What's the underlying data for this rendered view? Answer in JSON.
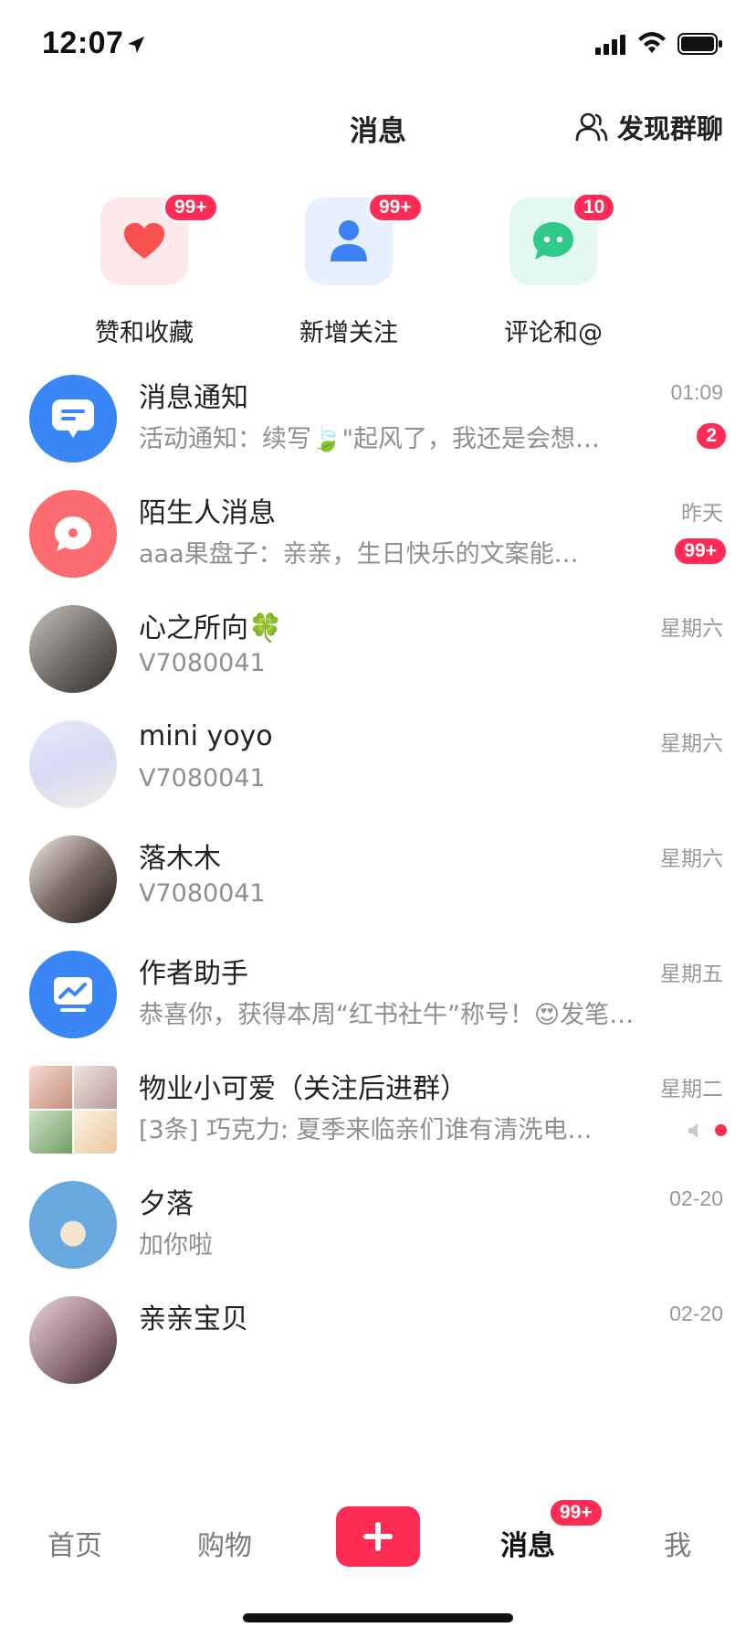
{
  "status_bar": {
    "time": "12:07"
  },
  "header": {
    "title": "消息",
    "discover_label": "发现群聊"
  },
  "shortcuts": [
    {
      "label": "赞和收藏",
      "badge": "99+",
      "icon": "heart-icon",
      "tile_color": "#fde9ea",
      "icon_color": "#f6504f"
    },
    {
      "label": "新增关注",
      "badge": "99+",
      "icon": "person-icon",
      "tile_color": "#e7f0fe",
      "icon_color": "#3b82f6"
    },
    {
      "label": "评论和@",
      "badge": "10",
      "icon": "chat-bubble-icon",
      "tile_color": "#e3f8ef",
      "icon_color": "#2fc98a"
    }
  ],
  "conversations": [
    {
      "title": "消息通知",
      "subtitle": "活动通知：续写🍃\"起风了，我还是会想…",
      "time": "01:09",
      "badge": "2"
    },
    {
      "title": "陌生人消息",
      "subtitle": "aaa果盘子：亲亲，生日快乐的文案能…",
      "time": "昨天",
      "badge": "99+"
    },
    {
      "title": "心之所向🍀",
      "subtitle": "V7080041",
      "time": "星期六"
    },
    {
      "title": "mini yoyo",
      "subtitle": "V7080041",
      "time": "星期六"
    },
    {
      "title": "落木木",
      "subtitle": "V7080041",
      "time": "星期六"
    },
    {
      "title": "作者助手",
      "subtitle": "恭喜你，获得本周“红书社牛”称号！😍发笔…",
      "time": "星期五"
    },
    {
      "title": "物业小可爱（关注后进群）",
      "subtitle": "[3条] 巧克力: 夏季来临亲们谁有清洗电…",
      "time": "星期二"
    },
    {
      "title": "夕落",
      "subtitle": "加你啦",
      "time": "02-20"
    },
    {
      "title": "亲亲宝贝",
      "subtitle": "",
      "time": "02-20"
    }
  ],
  "nav": {
    "items": [
      "首页",
      "购物",
      "消息",
      "我"
    ],
    "messages_badge": "99+",
    "accent": "#fe2c55"
  }
}
